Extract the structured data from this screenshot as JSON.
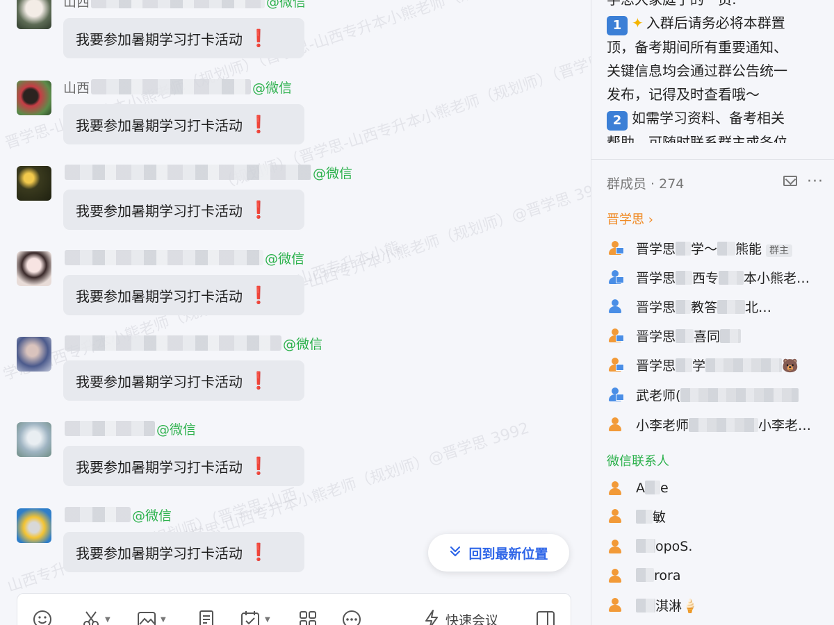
{
  "chat": {
    "messages": [
      {
        "sender_prefix": "山西",
        "tag": "@微信",
        "text": "我要参加暑期学习打卡活动",
        "mark": "❗"
      },
      {
        "sender_prefix": "山西",
        "tag": "@微信",
        "text": "我要参加暑期学习打卡活动",
        "mark": "❗"
      },
      {
        "sender_prefix": "",
        "tag": "@微信",
        "text": "我要参加暑期学习打卡活动",
        "mark": "❗"
      },
      {
        "sender_prefix": "",
        "tag": "@微信",
        "text": "我要参加暑期学习打卡活动",
        "mark": "❗"
      },
      {
        "sender_prefix": "",
        "tag": "@微信",
        "text": "我要参加暑期学习打卡活动",
        "mark": "❗"
      },
      {
        "sender_prefix": "",
        "tag": "@微信",
        "text": "我要参加暑期学习打卡活动",
        "mark": "❗"
      },
      {
        "sender_prefix": "",
        "tag": "@微信",
        "text": "我要参加暑期学习打卡活动",
        "mark": "❗"
      }
    ],
    "watermarks": [
      "晋学思-山西专升本小熊老师（规划师）（晋学思-山西专升本小熊老师（规",
      "（规划师）（晋学思-山西专升本小熊老师（规划师）（晋学思-山西",
      "晋学思-山西专升本小熊老师（规划师）@晋学思 3992",
      "学思-山西专升本小熊老师（规划师）（晋学思-山西专升本小熊",
      "晋学思-山西专升本小熊老师（规划师）@晋学思 3992",
      "山西专升本小熊老师（规划师）（晋学思-山西"
    ],
    "back_to_latest": "回到最新位置",
    "toolbar": {
      "quick_meeting": "快速会议"
    }
  },
  "notice": {
    "line0": "学思大家庭了的一员:",
    "item1_badge": "1",
    "item1_l1": "入群后请务必将本群置",
    "item1_l2": "顶，备考期间所有重要通知、",
    "item1_l3": "关键信息均会通过群公告统一",
    "item1_l4": "发布，记得及时查看哦～",
    "item2_badge": "2",
    "item2_l1": "如需学习资料、备考相关",
    "item2_l2": "帮助，可随时联系群主或各位"
  },
  "members": {
    "title": "群成员 · 274",
    "group1": "晋学思 ›",
    "group1_items": [
      {
        "prefix": "晋学思",
        "suffix": "学～",
        "tail": "熊能",
        "tag": "群主"
      },
      {
        "prefix": "晋学思",
        "suffix": "西专",
        "tail": "本小熊老…"
      },
      {
        "prefix": "晋学思",
        "suffix": "教答",
        "tail": "北…"
      },
      {
        "prefix": "晋学思",
        "suffix": "喜同",
        "tail": ""
      },
      {
        "prefix": "晋学思",
        "suffix": "学",
        "tail": "🐻"
      },
      {
        "prefix": "武老师(",
        "suffix": "",
        "tail": ""
      },
      {
        "prefix": "小李老师",
        "suffix": "",
        "tail": "小李老…"
      }
    ],
    "group2": "微信联系人",
    "group2_items": [
      {
        "prefix": "A",
        "suffix": "e"
      },
      {
        "prefix": "",
        "suffix": "敏"
      },
      {
        "prefix": "",
        "suffix": "opoS."
      },
      {
        "prefix": "",
        "suffix": "rora"
      },
      {
        "prefix": "",
        "suffix": "淇淋🍦"
      }
    ]
  }
}
